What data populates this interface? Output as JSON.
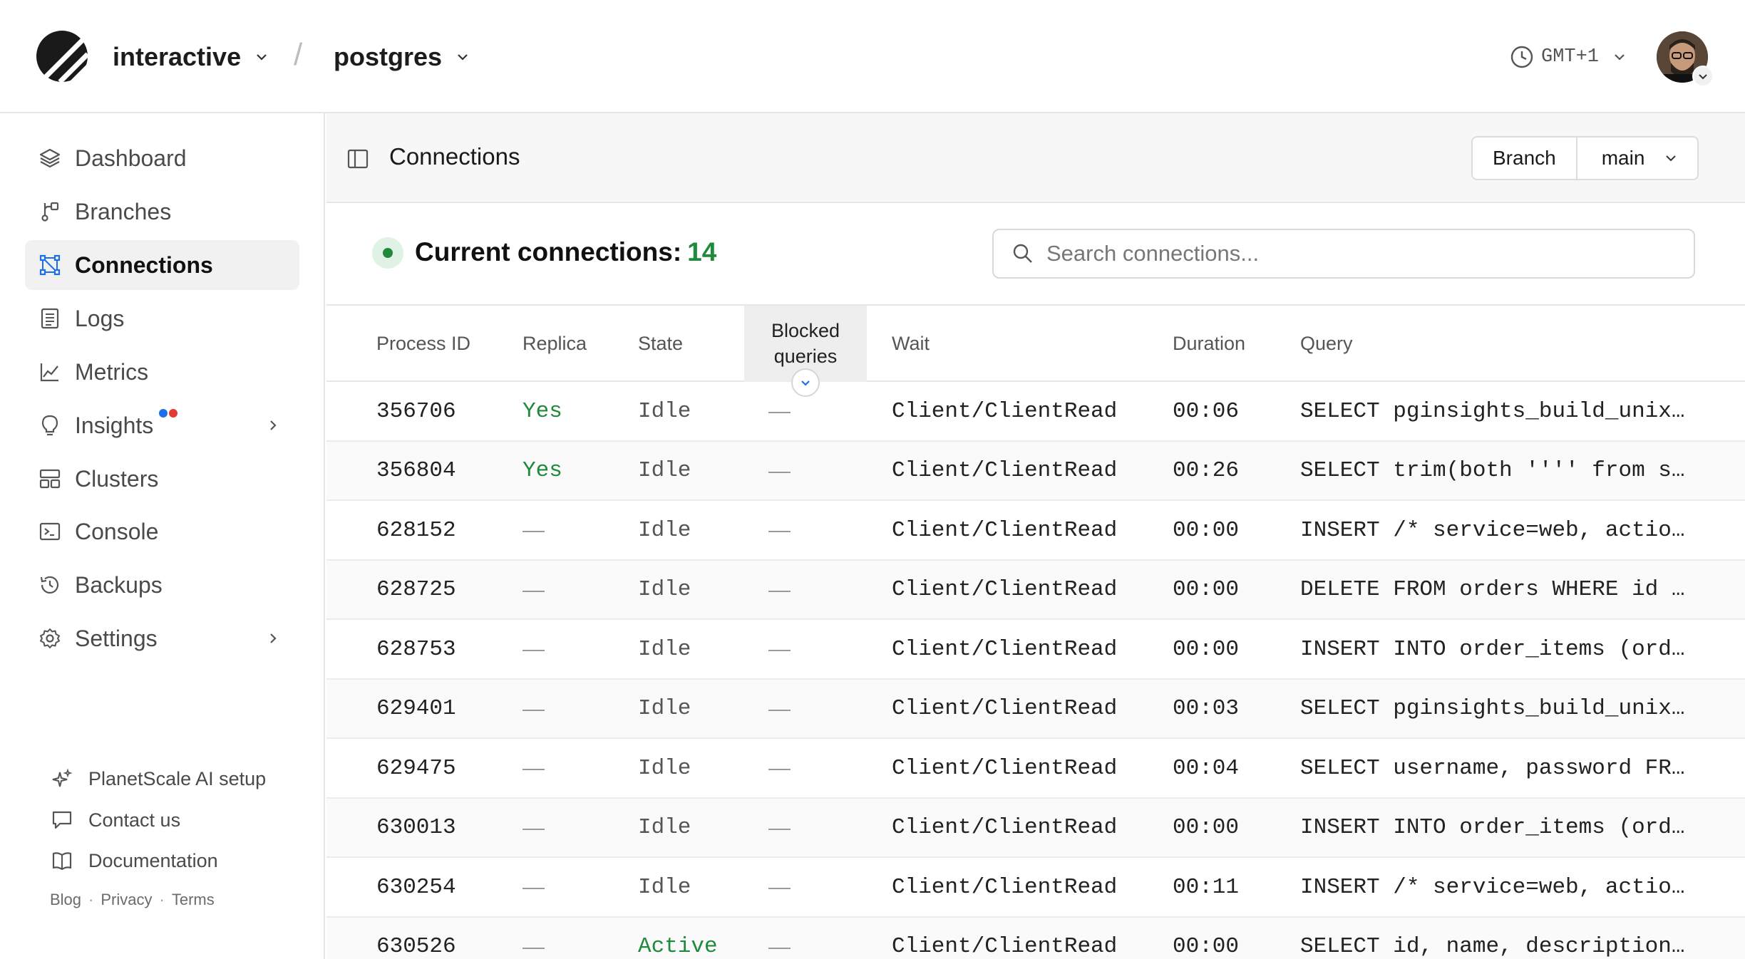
{
  "header": {
    "org_name": "interactive",
    "separator": "/",
    "database_name": "postgres",
    "timezone": "GMT+1",
    "icons": {
      "logo": "planetscale-logo",
      "clock": "clock-icon",
      "chevron": "chevron-down-icon"
    }
  },
  "sidebar": {
    "items": [
      {
        "label": "Dashboard",
        "icon": "layers-icon"
      },
      {
        "label": "Branches",
        "icon": "branch-icon"
      },
      {
        "label": "Connections",
        "icon": "connections-icon",
        "active": true
      },
      {
        "label": "Logs",
        "icon": "logs-icon"
      },
      {
        "label": "Metrics",
        "icon": "metrics-icon"
      },
      {
        "label": "Insights",
        "icon": "lightbulb-icon",
        "has_submenu": true
      },
      {
        "label": "Clusters",
        "icon": "clusters-icon"
      },
      {
        "label": "Console",
        "icon": "terminal-icon"
      },
      {
        "label": "Backups",
        "icon": "backups-icon"
      },
      {
        "label": "Settings",
        "icon": "gear-icon",
        "has_submenu": true
      }
    ],
    "footer_links": [
      {
        "label": "PlanetScale AI setup",
        "icon": "sparkle-icon"
      },
      {
        "label": "Contact us",
        "icon": "chat-icon"
      },
      {
        "label": "Documentation",
        "icon": "book-icon"
      }
    ],
    "legal": {
      "blog": "Blog",
      "privacy": "Privacy",
      "terms": "Terms",
      "dot": "·"
    }
  },
  "page": {
    "title": "Connections",
    "branch_label": "Branch",
    "branch_value": "main"
  },
  "summary": {
    "label": "Current connections:",
    "count": "14",
    "status_color": "#1f8a3b"
  },
  "search": {
    "placeholder": "Search connections..."
  },
  "table": {
    "columns": [
      "Process ID",
      "Replica",
      "State",
      "Blocked queries",
      "Wait",
      "Duration",
      "Query"
    ],
    "rows": [
      {
        "pid": "356706",
        "replica": "Yes",
        "state": "Idle",
        "blocked": "—",
        "wait": "Client/ClientRead",
        "duration": "00:06",
        "query": "SELECT pginsights_build_unix…"
      },
      {
        "pid": "356804",
        "replica": "Yes",
        "state": "Idle",
        "blocked": "—",
        "wait": "Client/ClientRead",
        "duration": "00:26",
        "query": "SELECT trim(both '''' from s…"
      },
      {
        "pid": "628152",
        "replica": "—",
        "state": "Idle",
        "blocked": "—",
        "wait": "Client/ClientRead",
        "duration": "00:00",
        "query": "INSERT /* service=web, actio…"
      },
      {
        "pid": "628725",
        "replica": "—",
        "state": "Idle",
        "blocked": "—",
        "wait": "Client/ClientRead",
        "duration": "00:00",
        "query": "DELETE FROM orders WHERE id …"
      },
      {
        "pid": "628753",
        "replica": "—",
        "state": "Idle",
        "blocked": "—",
        "wait": "Client/ClientRead",
        "duration": "00:00",
        "query": "INSERT INTO order_items (ord…"
      },
      {
        "pid": "629401",
        "replica": "—",
        "state": "Idle",
        "blocked": "—",
        "wait": "Client/ClientRead",
        "duration": "00:03",
        "query": "SELECT pginsights_build_unix…"
      },
      {
        "pid": "629475",
        "replica": "—",
        "state": "Idle",
        "blocked": "—",
        "wait": "Client/ClientRead",
        "duration": "00:04",
        "query": "SELECT username, password FR…"
      },
      {
        "pid": "630013",
        "replica": "—",
        "state": "Idle",
        "blocked": "—",
        "wait": "Client/ClientRead",
        "duration": "00:00",
        "query": "INSERT INTO order_items (ord…"
      },
      {
        "pid": "630254",
        "replica": "—",
        "state": "Idle",
        "blocked": "—",
        "wait": "Client/ClientRead",
        "duration": "00:11",
        "query": "INSERT /* service=web, actio…"
      },
      {
        "pid": "630526",
        "replica": "—",
        "state": "Active",
        "blocked": "—",
        "wait": "Client/ClientRead",
        "duration": "00:00",
        "query": "SELECT id, name, description…"
      }
    ]
  },
  "colors": {
    "accent_green": "#1f8a3b",
    "insights_dot_blue": "#1d6fe8",
    "insights_dot_red": "#e53935",
    "connections_icon_blue": "#1d6fe8"
  }
}
